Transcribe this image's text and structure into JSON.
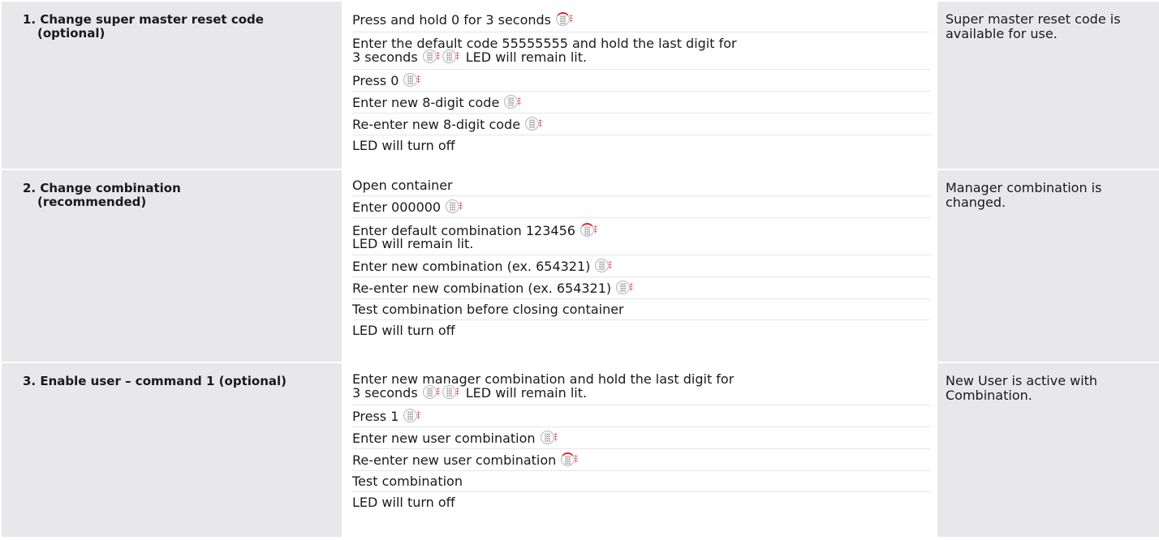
{
  "colors": {
    "accent_red": "#e1232e",
    "cell_gray": "#e8e8ea"
  },
  "rows": [
    {
      "title_line1": "1. Change super master reset code",
      "title_line2": "(optional)",
      "steps": [
        {
          "text": "Press and hold 0 for 3 seconds",
          "icons": [
            "beep-red-icon"
          ]
        },
        {
          "line1": "Enter the default code 55555555 and hold the last digit for",
          "line2": "3 seconds",
          "icons": [
            "beep-icon",
            "beep-icon"
          ],
          "suffix": "LED will remain lit."
        },
        {
          "text": "Press 0",
          "icons": [
            "beep-icon"
          ]
        },
        {
          "text": "Enter new 8-digit code",
          "icons": [
            "beep-icon"
          ]
        },
        {
          "text": "Re-enter new 8-digit code",
          "icons": [
            "beep-icon"
          ]
        },
        {
          "text": "LED will turn off"
        }
      ],
      "result": "Super master reset code is available for use."
    },
    {
      "title_line1": "2. Change combination",
      "title_line2": "(recommended)",
      "steps": [
        {
          "text": "Open container"
        },
        {
          "text": "Enter 000000",
          "icons": [
            "beep-icon"
          ]
        },
        {
          "line1": "Enter default combination 123456",
          "line2": "LED will remain lit.",
          "icons": [
            "beep-red-icon"
          ]
        },
        {
          "text": "Enter new combination (ex. 654321)",
          "icons": [
            "beep-icon"
          ]
        },
        {
          "text": "Re-enter new combination (ex. 654321)",
          "icons": [
            "beep-icon"
          ]
        },
        {
          "text": "Test combination before closing container"
        },
        {
          "text": "LED will turn off"
        }
      ],
      "result": "Manager combination is changed."
    },
    {
      "title_line1": "3. Enable user – command 1 (optional)",
      "steps": [
        {
          "line1": "Enter new manager combination and hold the last digit for",
          "line2": "3 seconds",
          "icons": [
            "beep-icon",
            "beep-icon"
          ],
          "suffix": "LED will remain lit."
        },
        {
          "text": "Press 1",
          "icons": [
            "beep-icon"
          ]
        },
        {
          "text": "Enter new user combination",
          "icons": [
            "beep-icon"
          ]
        },
        {
          "text": "Re-enter new user combination",
          "icons": [
            "beep-red-icon"
          ]
        },
        {
          "text": "Test combination"
        },
        {
          "text": "LED will turn off"
        }
      ],
      "result": "New User is active with Combination."
    }
  ]
}
